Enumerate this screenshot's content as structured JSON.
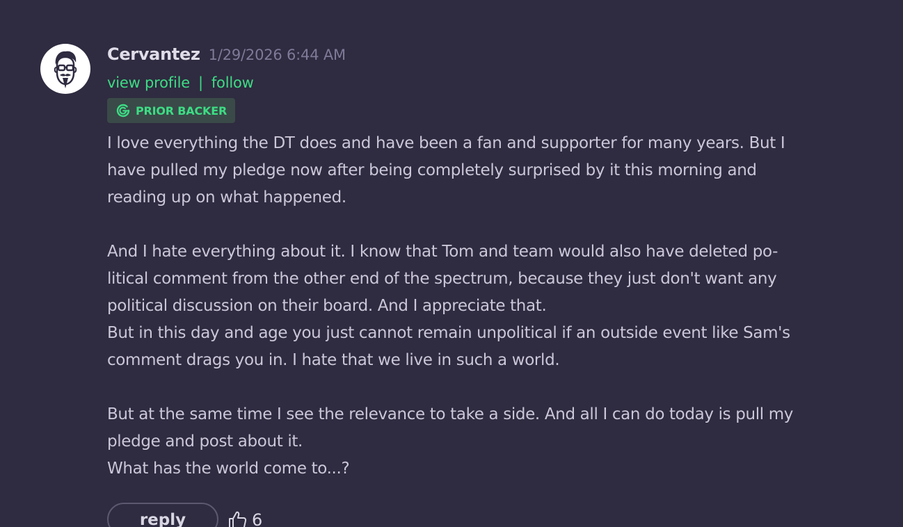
{
  "comment": {
    "author": "Cervantez",
    "timestamp": "1/29/2026 6:44 AM",
    "links": {
      "view_profile": "view profile",
      "separator": "|",
      "follow": "follow"
    },
    "badge": {
      "label": "PRIOR BACKER",
      "icon": "prior-backer-icon"
    },
    "lines": [
      "I love everything the DT does and have been a fan and supporter for many years. But I",
      "have pulled my pledge now after being completely surprised by it this morning and",
      "reading up on what happened.",
      "",
      "And I hate everything about it. I know that Tom and team would also have deleted po-",
      "litical comment from the other end of the spectrum, because they just don't want any",
      "political discussion on their board. And I appreciate that.",
      "But in this day and age you just cannot remain unpolitical if an outside event like Sam's",
      "comment drags you in. I hate that we live in such a world.",
      "",
      "But at the same time I see the relevance to take a side. And all I can do today is pull my",
      "pledge and post about it.",
      "What has the world come to...?"
    ],
    "actions": {
      "reply_label": "reply",
      "like_count": "6",
      "like_icon": "thumbs-up-icon"
    }
  },
  "colors": {
    "background": "#2f2b40",
    "accent_green": "#3ddc84",
    "text": "#cbc7d8",
    "muted": "#7f7a98"
  }
}
